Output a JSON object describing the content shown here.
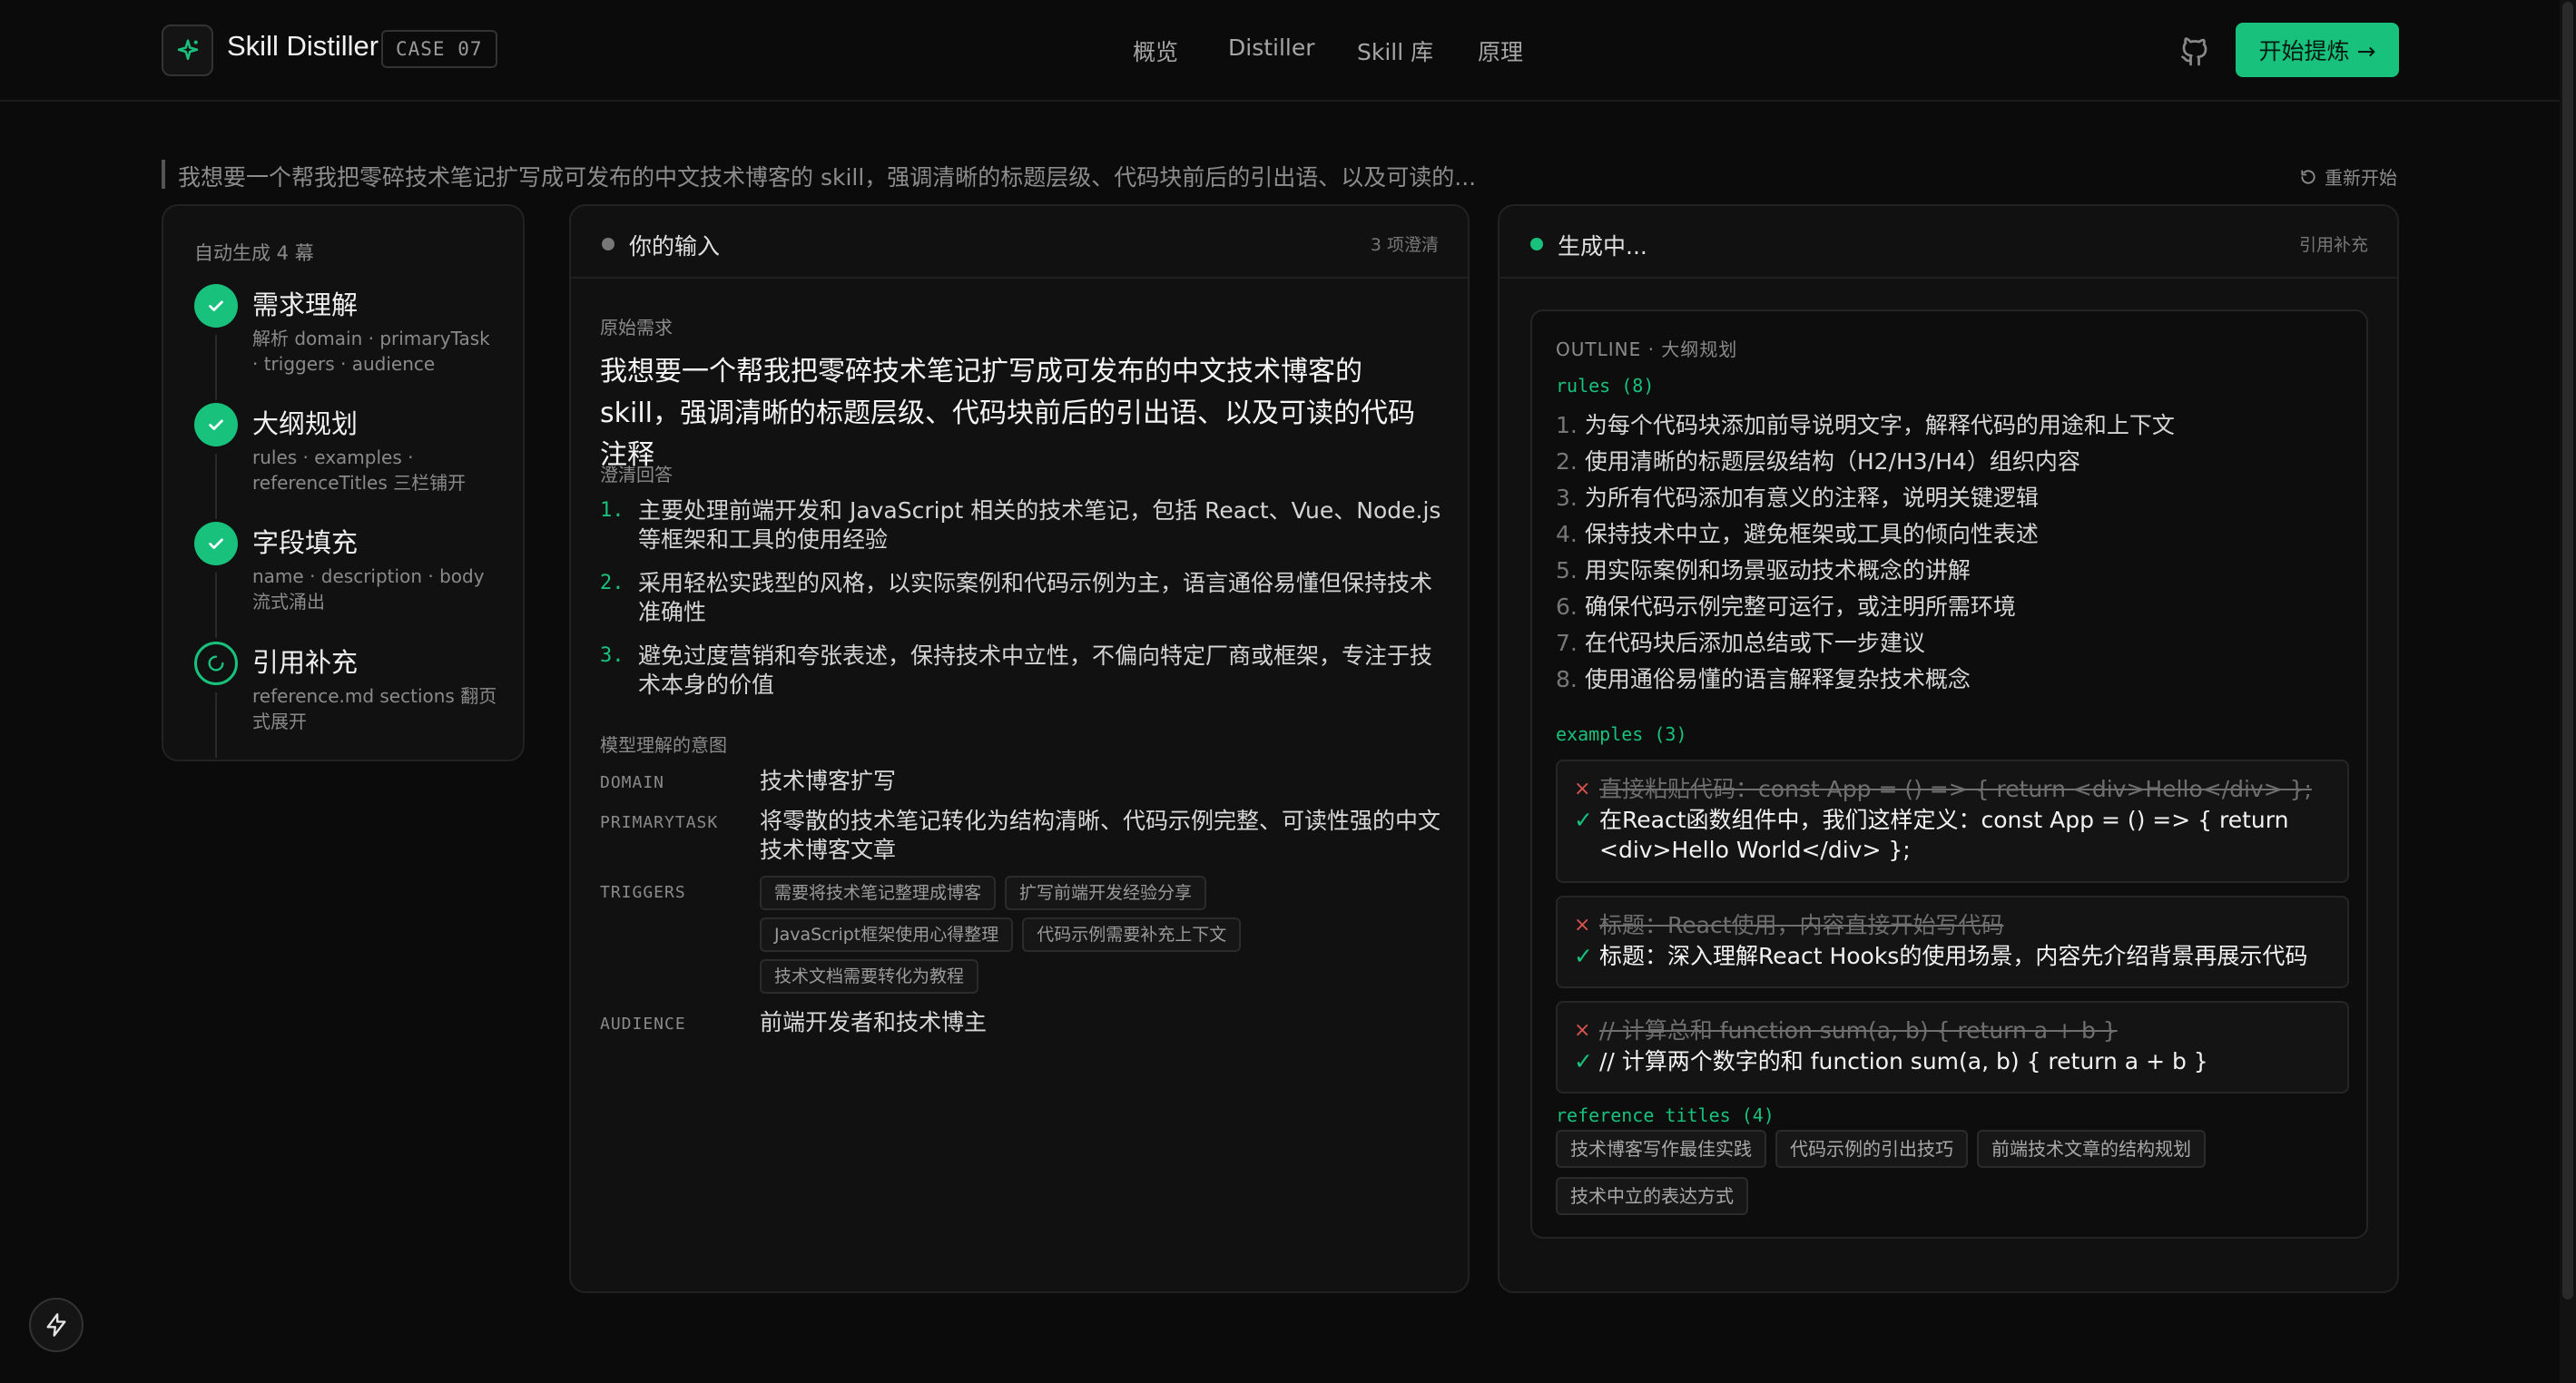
{
  "header": {
    "brand": "Skill Distiller",
    "case_badge": "CASE 07",
    "nav": [
      "概览",
      "Distiller",
      "Skill 库",
      "原理"
    ],
    "start_button": "开始提炼 →"
  },
  "prompt_bar": {
    "text": "我想要一个帮我把零碎技术笔记扩写成可发布的中文技术博客的 skill，强调清晰的标题层级、代码块前后的引出语、以及可读的...",
    "restart_label": "重新开始"
  },
  "steps": {
    "title": "自动生成 4 幕",
    "items": [
      {
        "title": "需求理解",
        "desc": "解析 domain · primaryTask · triggers · audience",
        "status": "done"
      },
      {
        "title": "大纲规划",
        "desc": "rules · examples · referenceTitles 三栏铺开",
        "status": "done"
      },
      {
        "title": "字段填充",
        "desc": "name · description · body 流式涌出",
        "status": "done"
      },
      {
        "title": "引用补充",
        "desc": "reference.md sections 翻页式展开",
        "status": "active"
      }
    ]
  },
  "input_panel": {
    "title": "你的输入",
    "right": "3 项澄清",
    "raw_label": "原始需求",
    "raw_text": "我想要一个帮我把零碎技术笔记扩写成可发布的中文技术博客的 skill，强调清晰的标题层级、代码块前后的引出语、以及可读的代码注释",
    "clar_label": "澄清回答",
    "clarifications": [
      {
        "num": "1.",
        "text": "主要处理前端开发和 JavaScript 相关的技术笔记，包括 React、Vue、Node.js 等框架和工具的使用经验"
      },
      {
        "num": "2.",
        "text": "采用轻松实践型的风格，以实际案例和代码示例为主，语言通俗易懂但保持技术准确性"
      },
      {
        "num": "3.",
        "text": "避免过度营销和夸张表述，保持技术中立性，不偏向特定厂商或框架，专注于技术本身的价值"
      }
    ],
    "intent_label": "模型理解的意图",
    "intent": {
      "domain_key": "DOMAIN",
      "domain": "技术博客扩写",
      "task_key": "PRIMARYTASK",
      "task": "将零散的技术笔记转化为结构清晰、代码示例完整、可读性强的中文技术博客文章",
      "triggers_key": "TRIGGERS",
      "triggers": [
        "需要将技术笔记整理成博客",
        "扩写前端开发经验分享",
        "JavaScript框架使用心得整理",
        "代码示例需要补充上下文",
        "技术文档需要转化为教程"
      ],
      "audience_key": "AUDIENCE",
      "audience": "前端开发者和技术博主"
    }
  },
  "gen_panel": {
    "title": "生成中...",
    "right": "引用补充",
    "outline_label": "OUTLINE · 大纲规划",
    "rules_label": "rules (8)",
    "rules": [
      "为每个代码块添加前导说明文字，解释代码的用途和上下文",
      "使用清晰的标题层级结构（H2/H3/H4）组织内容",
      "为所有代码添加有意义的注释，说明关键逻辑",
      "保持技术中立，避免框架或工具的倾向性表述",
      "用实际案例和场景驱动技术概念的讲解",
      "确保代码示例完整可运行，或注明所需环境",
      "在代码块后添加总结或下一步建议",
      "使用通俗易懂的语言解释复杂技术概念"
    ],
    "rule_nums": [
      "1.",
      "2.",
      "3.",
      "4.",
      "5.",
      "6.",
      "7.",
      "8."
    ],
    "examples_label": "examples (3)",
    "examples": [
      {
        "bad": "直接粘贴代码：const App = () => { return <div>Hello</div> };",
        "good": "在React函数组件中，我们这样定义：const App = () => { return <div>Hello World</div> };"
      },
      {
        "bad": "标题：React使用，内容直接开始写代码",
        "good": "标题：深入理解React Hooks的使用场景，内容先介绍背景再展示代码"
      },
      {
        "bad": "// 计算总和 function sum(a, b) { return a + b }",
        "good": "// 计算两个数字的和 function sum(a, b) { return a + b }"
      }
    ],
    "refs_label": "reference titles (4)",
    "refs": [
      "技术博客写作最佳实践",
      "代码示例的引出技巧",
      "前端技术文章的结构规划",
      "技术中立的表达方式"
    ]
  },
  "colors": {
    "accent": "#18c27d",
    "background": "#0b0b0b",
    "panel": "#111111",
    "error": "#d9534f"
  }
}
